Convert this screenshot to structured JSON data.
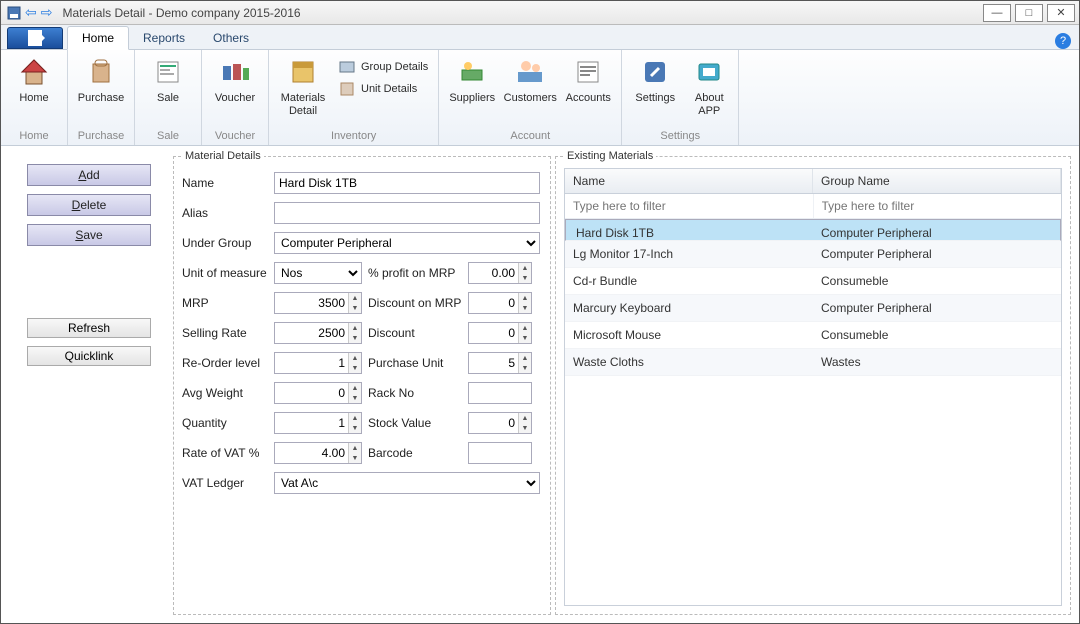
{
  "window": {
    "title": "Materials Detail - Demo company 2015-2016"
  },
  "tabs": {
    "home": "Home",
    "reports": "Reports",
    "others": "Others"
  },
  "ribbon": {
    "home": {
      "label": "Home",
      "btn": "Home"
    },
    "purchase": {
      "label": "Purchase",
      "btn": "Purchase"
    },
    "sale": {
      "label": "Sale",
      "btn": "Sale"
    },
    "voucher": {
      "label": "Voucher",
      "btn": "Voucher"
    },
    "inventory": {
      "label": "Inventory",
      "materials_detail": "Materials\nDetail",
      "group_details": "Group Details",
      "unit_details": "Unit Details"
    },
    "account": {
      "label": "Account",
      "suppliers": "Suppliers",
      "customers": "Customers",
      "accounts": "Accounts"
    },
    "settings": {
      "label": "Settings",
      "settings": "Settings",
      "about": "About\nAPP"
    }
  },
  "sidebar": {
    "add": "Add",
    "delete": "Delete",
    "save": "Save",
    "refresh": "Refresh",
    "quicklink": "Quicklink"
  },
  "form": {
    "legend": "Material Details",
    "labels": {
      "name": "Name",
      "alias": "Alias",
      "under_group": "Under Group",
      "unit_of_measure": "Unit of measure",
      "pct_profit_mrp": "% profit on MRP",
      "mrp": "MRP",
      "discount_on_mrp": "Discount on MRP",
      "selling_rate": "Selling Rate",
      "discount": "Discount",
      "reorder_level": "Re-Order level",
      "purchase_unit": "Purchase Unit",
      "avg_weight": "Avg Weight",
      "rack_no": "Rack No",
      "quantity": "Quantity",
      "stock_value": "Stock Value",
      "rate_of_vat": "Rate of VAT %",
      "barcode": "Barcode",
      "vat_ledger": "VAT Ledger"
    },
    "values": {
      "name": "Hard Disk 1TB",
      "alias": "",
      "under_group": "Computer Peripheral",
      "unit_of_measure": "Nos",
      "pct_profit_mrp": "0.00",
      "mrp": "3500",
      "discount_on_mrp": "0",
      "selling_rate": "2500",
      "discount": "0",
      "reorder_level": "1",
      "purchase_unit": "5",
      "avg_weight": "0",
      "rack_no": "",
      "quantity": "1",
      "stock_value": "0",
      "rate_of_vat": "4.00",
      "barcode": "",
      "vat_ledger": "Vat A\\c"
    }
  },
  "grid": {
    "legend": "Existing Materials",
    "headers": {
      "name": "Name",
      "group": "Group Name"
    },
    "filter_placeholder": "Type here to filter",
    "rows": [
      {
        "name": "Hard Disk 1TB",
        "group": "Computer Peripheral",
        "selected": true
      },
      {
        "name": "Lg Monitor 17-Inch",
        "group": "Computer Peripheral",
        "selected": false
      },
      {
        "name": "Cd-r Bundle",
        "group": "Consumeble",
        "selected": false
      },
      {
        "name": "Marcury Keyboard",
        "group": "Computer Peripheral",
        "selected": false
      },
      {
        "name": "Microsoft Mouse",
        "group": "Consumeble",
        "selected": false
      },
      {
        "name": "Waste Cloths",
        "group": "Wastes",
        "selected": false
      }
    ]
  }
}
